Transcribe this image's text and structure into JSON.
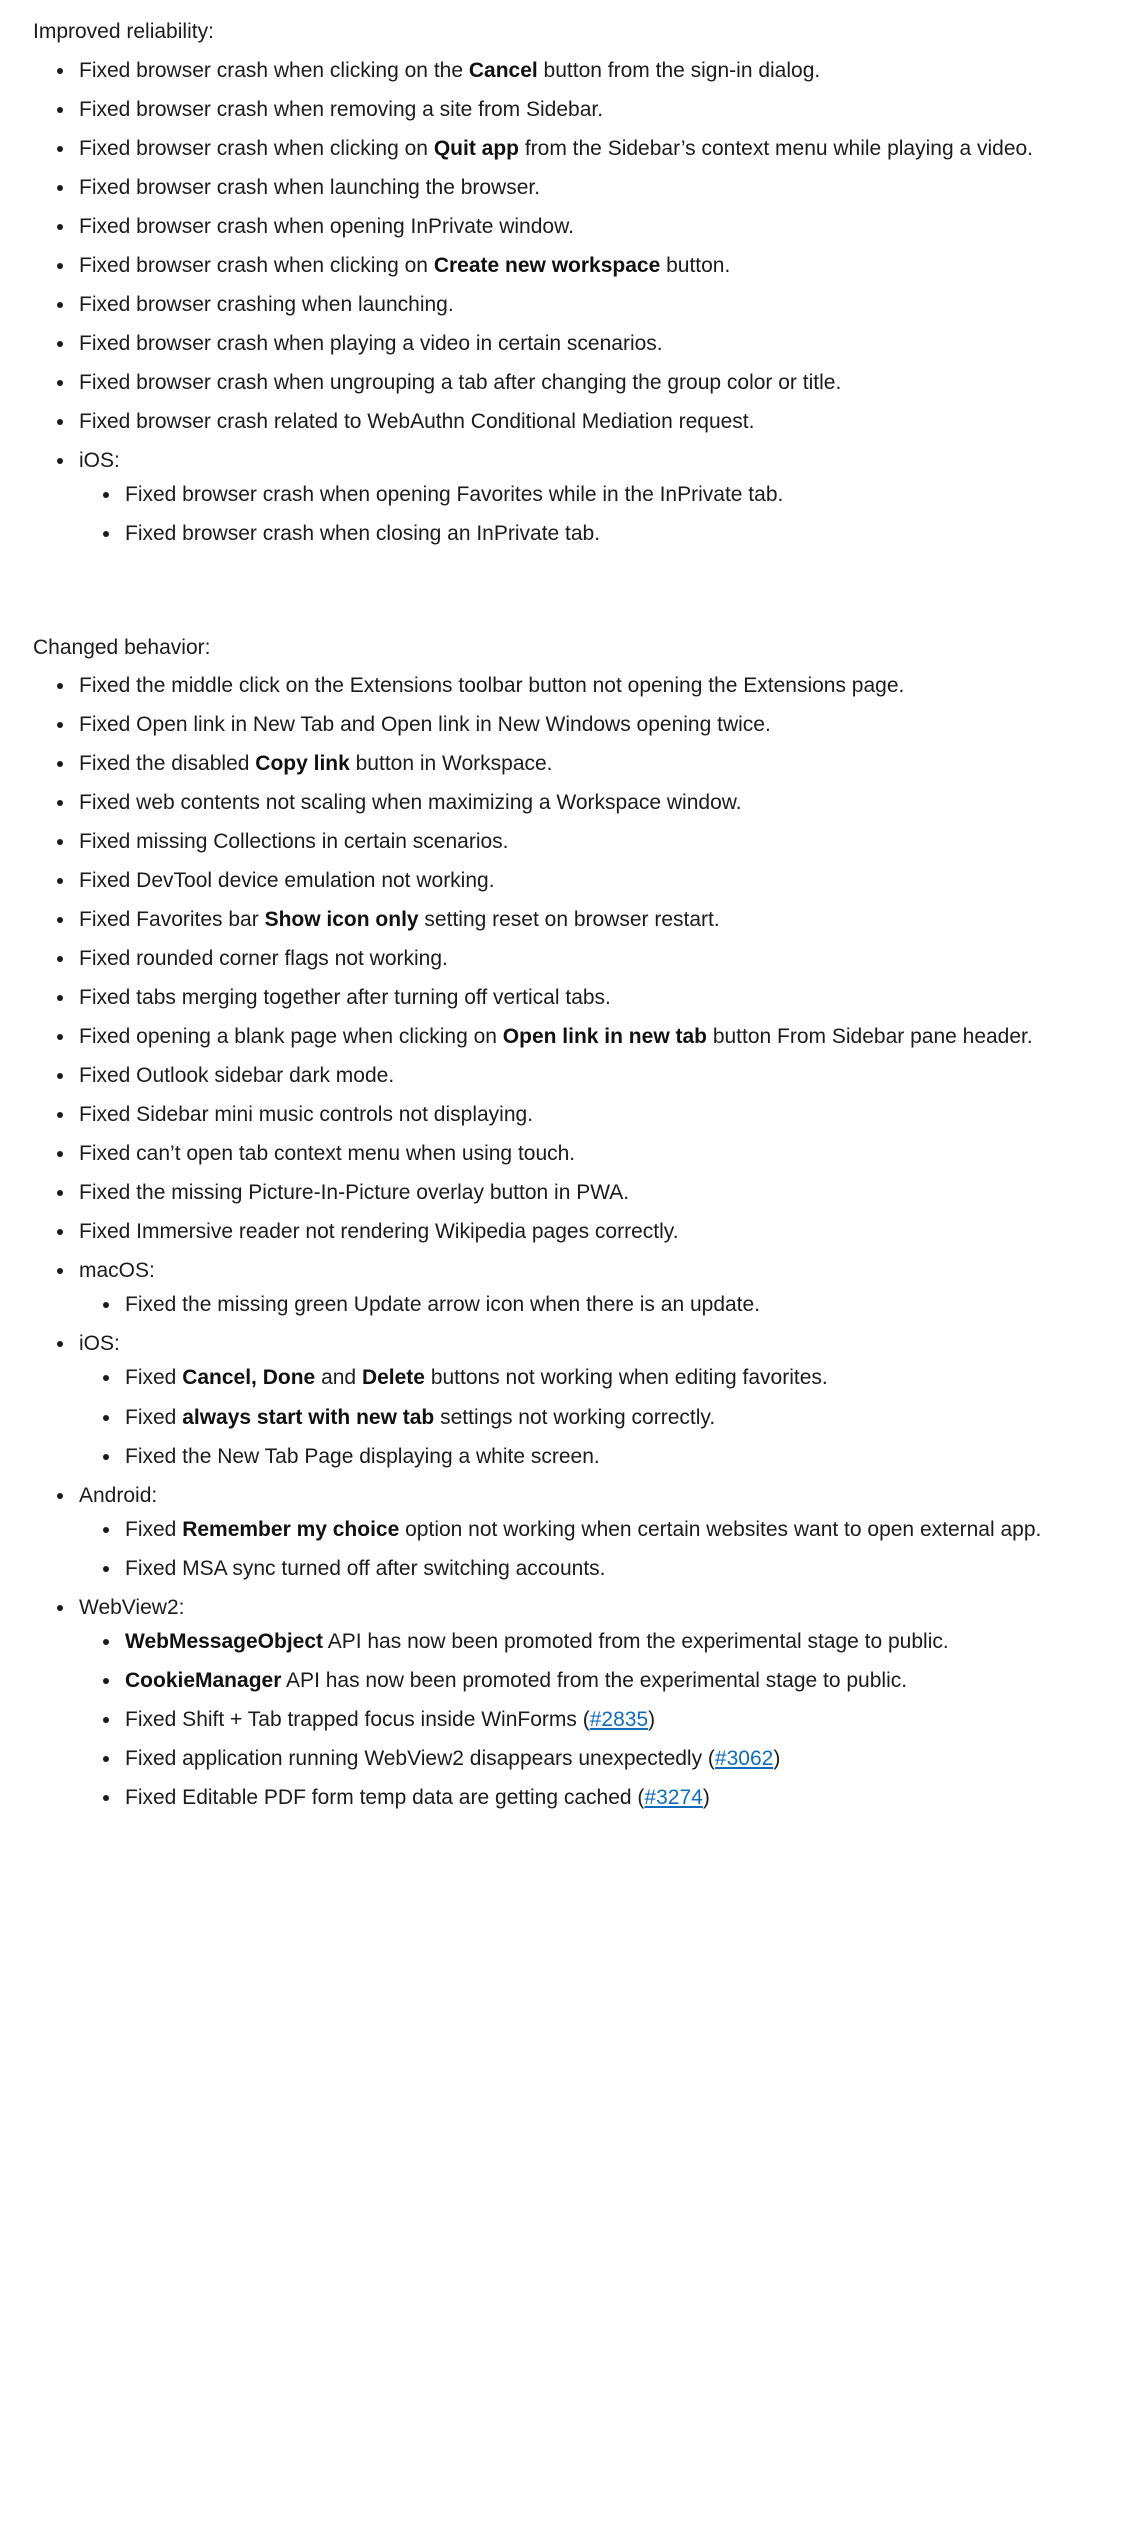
{
  "document": {
    "sections": [
      {
        "heading": "Improved reliability:",
        "items": [
          {
            "parts": [
              {
                "t": "Fixed browser crash when clicking on the "
              },
              {
                "t": "Cancel",
                "b": true
              },
              {
                "t": " button from the sign-in dialog."
              }
            ]
          },
          {
            "parts": [
              {
                "t": "Fixed browser crash when removing a site from Sidebar."
              }
            ]
          },
          {
            "parts": [
              {
                "t": "Fixed browser crash when clicking on "
              },
              {
                "t": "Quit app",
                "b": true
              },
              {
                "t": " from the Sidebar’s context menu while playing a video."
              }
            ]
          },
          {
            "parts": [
              {
                "t": "Fixed browser crash when launching the browser."
              }
            ]
          },
          {
            "parts": [
              {
                "t": "Fixed browser crash when opening InPrivate window."
              }
            ]
          },
          {
            "parts": [
              {
                "t": "Fixed browser crash when clicking on "
              },
              {
                "t": "Create new workspace",
                "b": true
              },
              {
                "t": " button."
              }
            ]
          },
          {
            "parts": [
              {
                "t": "Fixed browser crashing when launching."
              }
            ]
          },
          {
            "parts": [
              {
                "t": "Fixed browser crash when playing a video in certain scenarios."
              }
            ]
          },
          {
            "parts": [
              {
                "t": "Fixed browser crash when ungrouping a tab after changing the group color or title."
              }
            ]
          },
          {
            "parts": [
              {
                "t": "Fixed browser crash related to WebAuthn Conditional Mediation request."
              }
            ]
          },
          {
            "parts": [
              {
                "t": "iOS:"
              }
            ],
            "children": [
              {
                "parts": [
                  {
                    "t": "Fixed browser crash when opening Favorites while in the InPrivate tab."
                  }
                ]
              },
              {
                "parts": [
                  {
                    "t": "Fixed browser crash when closing an InPrivate tab."
                  }
                ]
              }
            ]
          }
        ]
      },
      {
        "heading": "Changed behavior:",
        "items": [
          {
            "parts": [
              {
                "t": "Fixed the middle click on the Extensions toolbar button not opening the Extensions page."
              }
            ]
          },
          {
            "parts": [
              {
                "t": "Fixed Open link in New Tab and Open link in New Windows opening twice."
              }
            ]
          },
          {
            "parts": [
              {
                "t": "Fixed the disabled "
              },
              {
                "t": "Copy link",
                "b": true
              },
              {
                "t": " button in Workspace."
              }
            ]
          },
          {
            "parts": [
              {
                "t": "Fixed web contents not scaling when maximizing a Workspace window."
              }
            ]
          },
          {
            "parts": [
              {
                "t": "Fixed missing Collections in certain scenarios."
              }
            ]
          },
          {
            "parts": [
              {
                "t": "Fixed DevTool device emulation not working."
              }
            ]
          },
          {
            "parts": [
              {
                "t": "Fixed Favorites bar "
              },
              {
                "t": "Show icon only",
                "b": true
              },
              {
                "t": " setting reset on browser restart."
              }
            ]
          },
          {
            "parts": [
              {
                "t": "Fixed rounded corner flags not working."
              }
            ]
          },
          {
            "parts": [
              {
                "t": "Fixed tabs merging together after turning off vertical tabs."
              }
            ]
          },
          {
            "parts": [
              {
                "t": "Fixed opening a blank page when clicking on "
              },
              {
                "t": "Open link in new tab",
                "b": true
              },
              {
                "t": " button From Sidebar pane header."
              }
            ]
          },
          {
            "parts": [
              {
                "t": "Fixed Outlook sidebar dark mode."
              }
            ]
          },
          {
            "parts": [
              {
                "t": "Fixed Sidebar mini music controls not displaying."
              }
            ]
          },
          {
            "parts": [
              {
                "t": "Fixed can’t open tab context menu when using touch."
              }
            ]
          },
          {
            "parts": [
              {
                "t": "Fixed the missing Picture-In-Picture overlay button in PWA."
              }
            ]
          },
          {
            "parts": [
              {
                "t": "Fixed Immersive reader not rendering Wikipedia pages correctly."
              }
            ]
          },
          {
            "parts": [
              {
                "t": "macOS:"
              }
            ],
            "children": [
              {
                "parts": [
                  {
                    "t": "Fixed the missing green Update arrow icon when there is an update."
                  }
                ]
              }
            ]
          },
          {
            "parts": [
              {
                "t": "iOS:"
              }
            ],
            "children": [
              {
                "parts": [
                  {
                    "t": "Fixed "
                  },
                  {
                    "t": "Cancel, Done",
                    "b": true
                  },
                  {
                    "t": " and "
                  },
                  {
                    "t": "Delete",
                    "b": true
                  },
                  {
                    "t": " buttons not working when editing favorites."
                  }
                ]
              },
              {
                "parts": [
                  {
                    "t": "Fixed "
                  },
                  {
                    "t": "always start with new tab",
                    "b": true
                  },
                  {
                    "t": " settings not working correctly."
                  }
                ]
              },
              {
                "parts": [
                  {
                    "t": "Fixed the New Tab Page displaying a white screen."
                  }
                ]
              }
            ]
          },
          {
            "parts": [
              {
                "t": "Android:"
              }
            ],
            "children": [
              {
                "parts": [
                  {
                    "t": "Fixed "
                  },
                  {
                    "t": "Remember my choice",
                    "b": true
                  },
                  {
                    "t": " option not working when certain websites want to open external app."
                  }
                ]
              },
              {
                "parts": [
                  {
                    "t": "Fixed MSA sync turned off after switching accounts."
                  }
                ]
              }
            ]
          },
          {
            "parts": [
              {
                "t": "WebView2:"
              }
            ],
            "children": [
              {
                "parts": [
                  {
                    "t": "WebMessageObject",
                    "b": true
                  },
                  {
                    "t": " API has now been promoted from the experimental stage to public."
                  }
                ]
              },
              {
                "parts": [
                  {
                    "t": "CookieManager",
                    "b": true
                  },
                  {
                    "t": " API has now been promoted from the experimental stage to public."
                  }
                ]
              },
              {
                "parts": [
                  {
                    "t": "Fixed Shift + Tab trapped focus inside WinForms ("
                  },
                  {
                    "t": "#2835",
                    "link": true
                  },
                  {
                    "t": ")"
                  }
                ]
              },
              {
                "parts": [
                  {
                    "t": "Fixed application running WebView2 disappears unexpectedly ("
                  },
                  {
                    "t": "#3062",
                    "link": true
                  },
                  {
                    "t": ")"
                  }
                ]
              },
              {
                "parts": [
                  {
                    "t": "Fixed Editable PDF form temp data are getting cached ("
                  },
                  {
                    "t": "#3274",
                    "link": true
                  },
                  {
                    "t": ")"
                  }
                ]
              }
            ]
          }
        ]
      }
    ]
  },
  "theme": {
    "text_color": "#1b1b1b",
    "link_color": "#0f6cbd",
    "background": "#ffffff"
  }
}
